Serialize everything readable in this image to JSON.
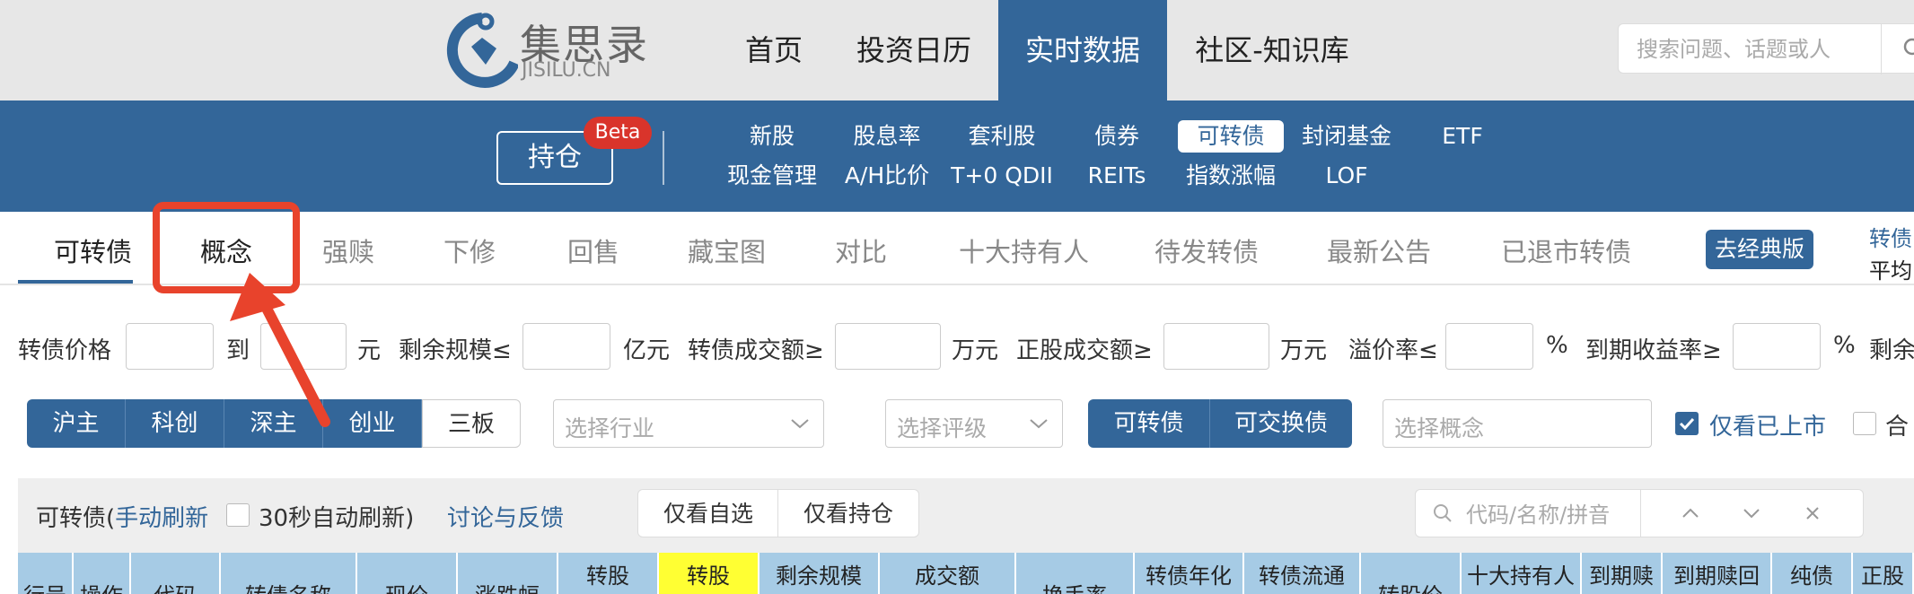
{
  "site": {
    "logo_cn": "集思录",
    "logo_en": "JISILU.CN"
  },
  "nav": {
    "items": [
      {
        "label": "首页"
      },
      {
        "label": "投资日历"
      },
      {
        "label": "实时数据",
        "active": true
      },
      {
        "label": "社区-知识库"
      }
    ],
    "search_placeholder": "搜索问题、话题或人"
  },
  "subnav": {
    "holdings_label": "持仓",
    "beta_label": "Beta",
    "row1": [
      "新股",
      "股息率",
      "套利股",
      "债券",
      "可转债",
      "封闭基金",
      "ETF"
    ],
    "row2": [
      "现金管理",
      "A/H比价",
      "T+0 QDII",
      "REITs",
      "指数涨幅",
      "LOF"
    ],
    "active": "可转债"
  },
  "tabs": {
    "items": [
      "可转债",
      "概念",
      "强赎",
      "下修",
      "回售",
      "藏宝图",
      "对比",
      "十大持有人",
      "待发转债",
      "最新公告",
      "已退市转债"
    ],
    "classic_label": "去经典版",
    "right_info_1": "转债",
    "right_info_2": "平均"
  },
  "filters": {
    "price_label": "转债价格",
    "to_label": "到",
    "yuan_label": "元",
    "remaining_label": "剩余规模≤",
    "yi_label": "亿元",
    "turnover_label": "转债成交额≥",
    "wan_label_1": "万元",
    "stock_turnover_label": "正股成交额≥",
    "wan_label_2": "万元",
    "premium_label": "溢价率≤",
    "pct_label_1": "%",
    "ytm_label": "到期收益率≥",
    "pct_label_2": "%",
    "more_label": "剩余"
  },
  "market_buttons": [
    "沪主",
    "科创",
    "深主",
    "创业",
    "三板"
  ],
  "selects": {
    "industry_placeholder": "选择行业",
    "rating_placeholder": "选择评级",
    "concept_placeholder": "选择概念"
  },
  "type_buttons": [
    "可转债",
    "可交换债"
  ],
  "checks": {
    "listed_label": "仅看已上市",
    "listed_checked": true,
    "merge_label": "合"
  },
  "panel": {
    "title_prefix": "可转债(",
    "manual_refresh": "手动刷新",
    "auto_refresh": "30秒自动刷新)",
    "feedback": "讨论与反馈",
    "watch_label": "仅看自选",
    "hold_label": "仅看持仓",
    "search_placeholder": "代码/名称/拼音"
  },
  "table_headers": [
    "行号",
    "操作",
    "代码",
    "转债名称",
    "现价",
    "涨跌幅",
    "转股",
    "转股",
    "剩余规模",
    "成交额",
    "换手率",
    "转债年化",
    "转债流通",
    "转股价",
    "十大持有人",
    "到期赎",
    "到期赎回",
    "纯债",
    "正股"
  ],
  "colors": {
    "brand_blue": "#336699",
    "header_blue": "#a6cbe5",
    "highlight_yellow": "#ffff33",
    "annotation_red": "#e8432c",
    "beta_red": "#d9342b"
  }
}
